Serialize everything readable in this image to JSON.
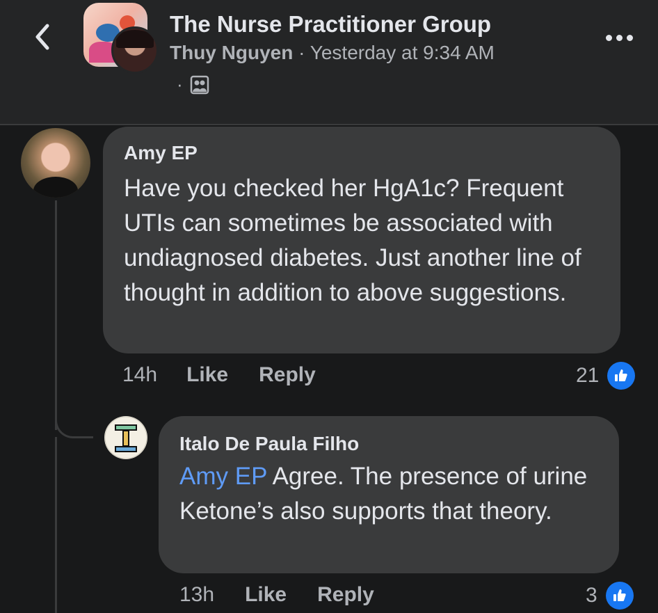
{
  "header": {
    "group_name": "The Nurse Practitioner Group",
    "author": "Thuy Nguyen",
    "separator": "·",
    "timestamp": "Yesterday at 9:34 AM",
    "audience_dot": "·",
    "icons": {
      "back": "chevron-left-icon",
      "more": "more-options-icon",
      "audience": "group-audience-icon"
    }
  },
  "comments": [
    {
      "author": "Amy EP",
      "text": "Have you checked her HgA1c? Frequent UTIs can sometimes be associated with undiagnosed diabetes. Just another line of thought in addition to above suggestions.",
      "time": "14h",
      "like_label": "Like",
      "reply_label": "Reply",
      "reaction_count": "21"
    }
  ],
  "replies": [
    {
      "author": "Italo De Paula Filho",
      "mention": "Amy EP",
      "text": " Agree. The presence of urine Ketone’s also supports that theory.",
      "time": "13h",
      "like_label": "Like",
      "reply_label": "Reply",
      "reaction_count": "3"
    }
  ],
  "colors": {
    "background": "#18191a",
    "header": "#242526",
    "bubble": "#3a3b3c",
    "mention": "#5f9bf6",
    "like": "#1877f2"
  }
}
